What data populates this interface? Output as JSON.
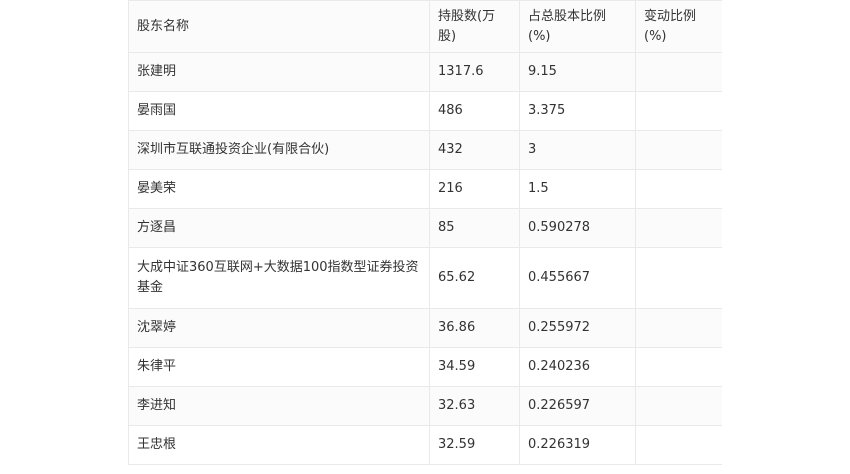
{
  "table": {
    "headers": [
      "股东名称",
      "持股数(万股)",
      "占总股本比例(%)",
      "变动比例(%)"
    ],
    "rows": [
      {
        "name": "张建明",
        "shares": "1317.6",
        "ratio": "9.15",
        "change": ""
      },
      {
        "name": "晏雨国",
        "shares": "486",
        "ratio": "3.375",
        "change": ""
      },
      {
        "name": "深圳市互联通投资企业(有限合伙)",
        "shares": "432",
        "ratio": "3",
        "change": ""
      },
      {
        "name": "晏美荣",
        "shares": "216",
        "ratio": "1.5",
        "change": ""
      },
      {
        "name": "方逐昌",
        "shares": "85",
        "ratio": "0.590278",
        "change": ""
      },
      {
        "name": "大成中证360互联网+大数据100指数型证券投资基金",
        "shares": "65.62",
        "ratio": "0.455667",
        "change": ""
      },
      {
        "name": "沈翠婷",
        "shares": "36.86",
        "ratio": "0.255972",
        "change": ""
      },
      {
        "name": "朱律平",
        "shares": "34.59",
        "ratio": "0.240236",
        "change": ""
      },
      {
        "name": "李进知",
        "shares": "32.63",
        "ratio": "0.226597",
        "change": ""
      },
      {
        "name": "王忠根",
        "shares": "32.59",
        "ratio": "0.226319",
        "change": ""
      }
    ]
  }
}
